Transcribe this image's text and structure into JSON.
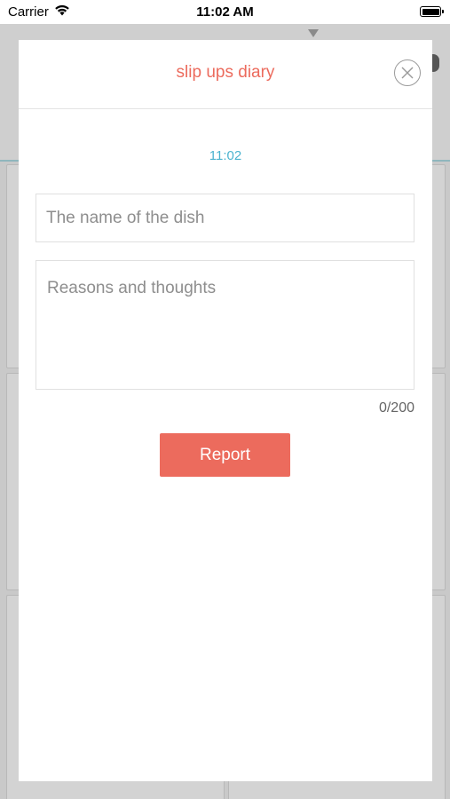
{
  "status_bar": {
    "carrier": "Carrier",
    "time": "11:02 AM",
    "wifi_icon": "wifi-icon",
    "battery_icon": "battery-icon"
  },
  "modal": {
    "title": "slip ups diary",
    "close_icon": "close-icon",
    "time": "11:02",
    "dish_field": {
      "placeholder": "The name of the dish",
      "value": ""
    },
    "reasons_field": {
      "placeholder": "Reasons and thoughts",
      "value": ""
    },
    "char_counter": "0/200",
    "report_label": "Report"
  },
  "colors": {
    "accent": "#ec6b5d",
    "time_text": "#4bb3cf",
    "overlay": "#bdbdbd"
  }
}
